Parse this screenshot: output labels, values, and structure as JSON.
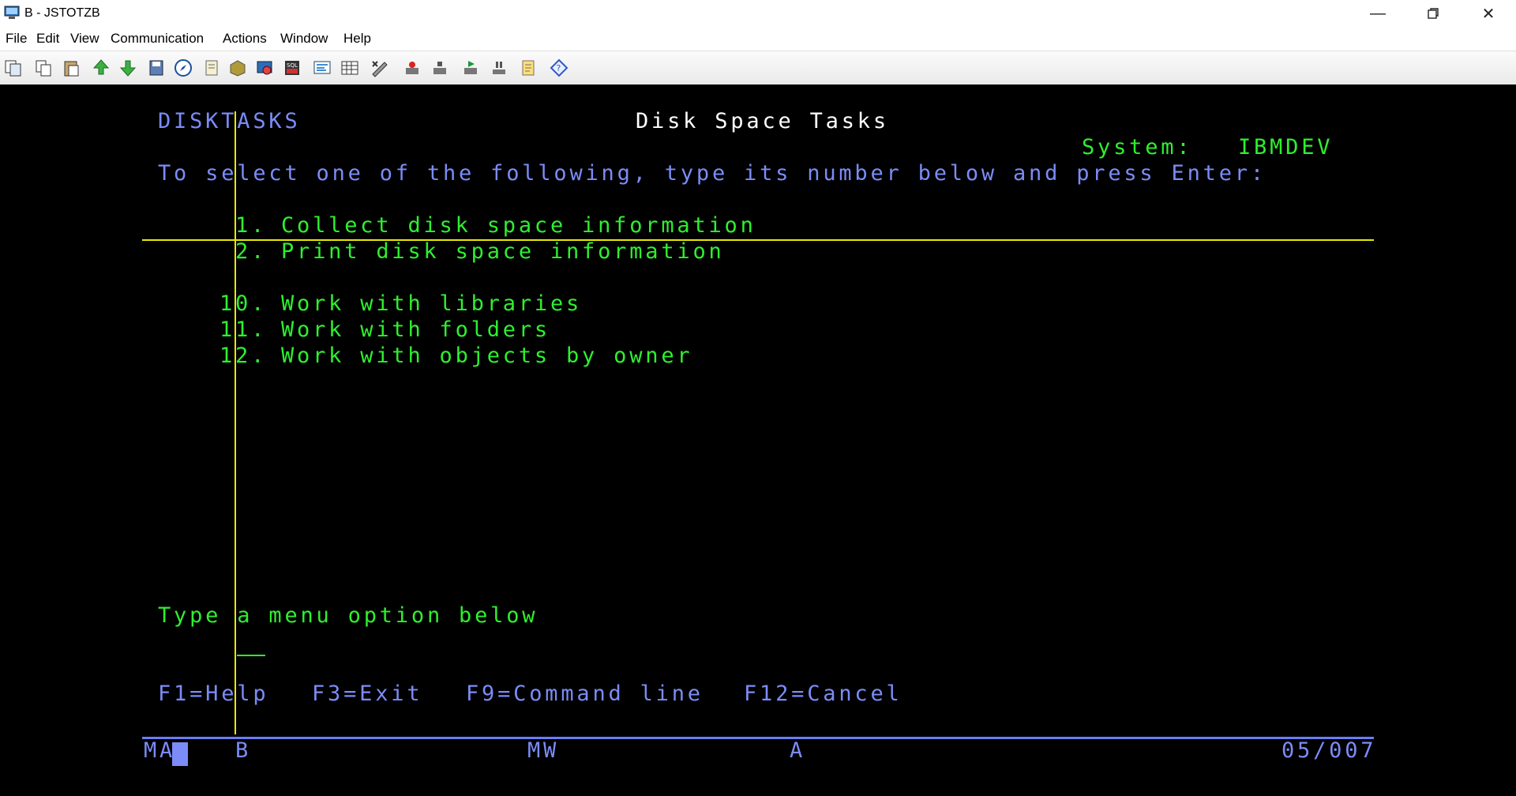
{
  "window": {
    "title": "B - JSTOTZB"
  },
  "menu": [
    "File",
    "Edit",
    "View",
    "Communication",
    "Actions",
    "Window",
    "Help"
  ],
  "toolbar": [
    "copy-icon",
    "copy-screen-icon",
    "paste-icon",
    "send-file-icon",
    "receive-file-icon",
    "save-icon",
    "navigate-icon",
    "notes-icon",
    "box-icon",
    "settings-icon",
    "sql-icon",
    "display-icon",
    "grid-icon",
    "edit-keys-icon",
    "macro-record-icon",
    "macro-stop-icon",
    "macro-play-icon",
    "pause-icon",
    "notepad-icon",
    "help-icon"
  ],
  "screen": {
    "menu_id": "DISKTASKS",
    "title": "Disk Space Tasks",
    "system_label": "System:",
    "system_value": "IBMDEV",
    "instruction": "To select one of the following, type its number below and press Enter:",
    "options": [
      {
        "num": "1.",
        "text": "Collect disk space information"
      },
      {
        "num": "2.",
        "text": "Print disk space information"
      },
      {
        "num": "10.",
        "text": "Work with libraries"
      },
      {
        "num": "11.",
        "text": "Work with folders"
      },
      {
        "num": "12.",
        "text": "Work with objects by owner"
      }
    ],
    "prompt": "Type a menu option below",
    "fkeys": [
      "F1=Help",
      "F3=Exit",
      "F9=Command line",
      "F12=Cancel"
    ]
  },
  "status": {
    "left": "MA",
    "session": "B",
    "mode": "MW",
    "indicator": "A",
    "position": "05/007"
  },
  "colors": {
    "screen_bg": "#000000",
    "green": "#2ef02e",
    "blue": "#7b8cf8",
    "crosshair": "#e8e800"
  }
}
